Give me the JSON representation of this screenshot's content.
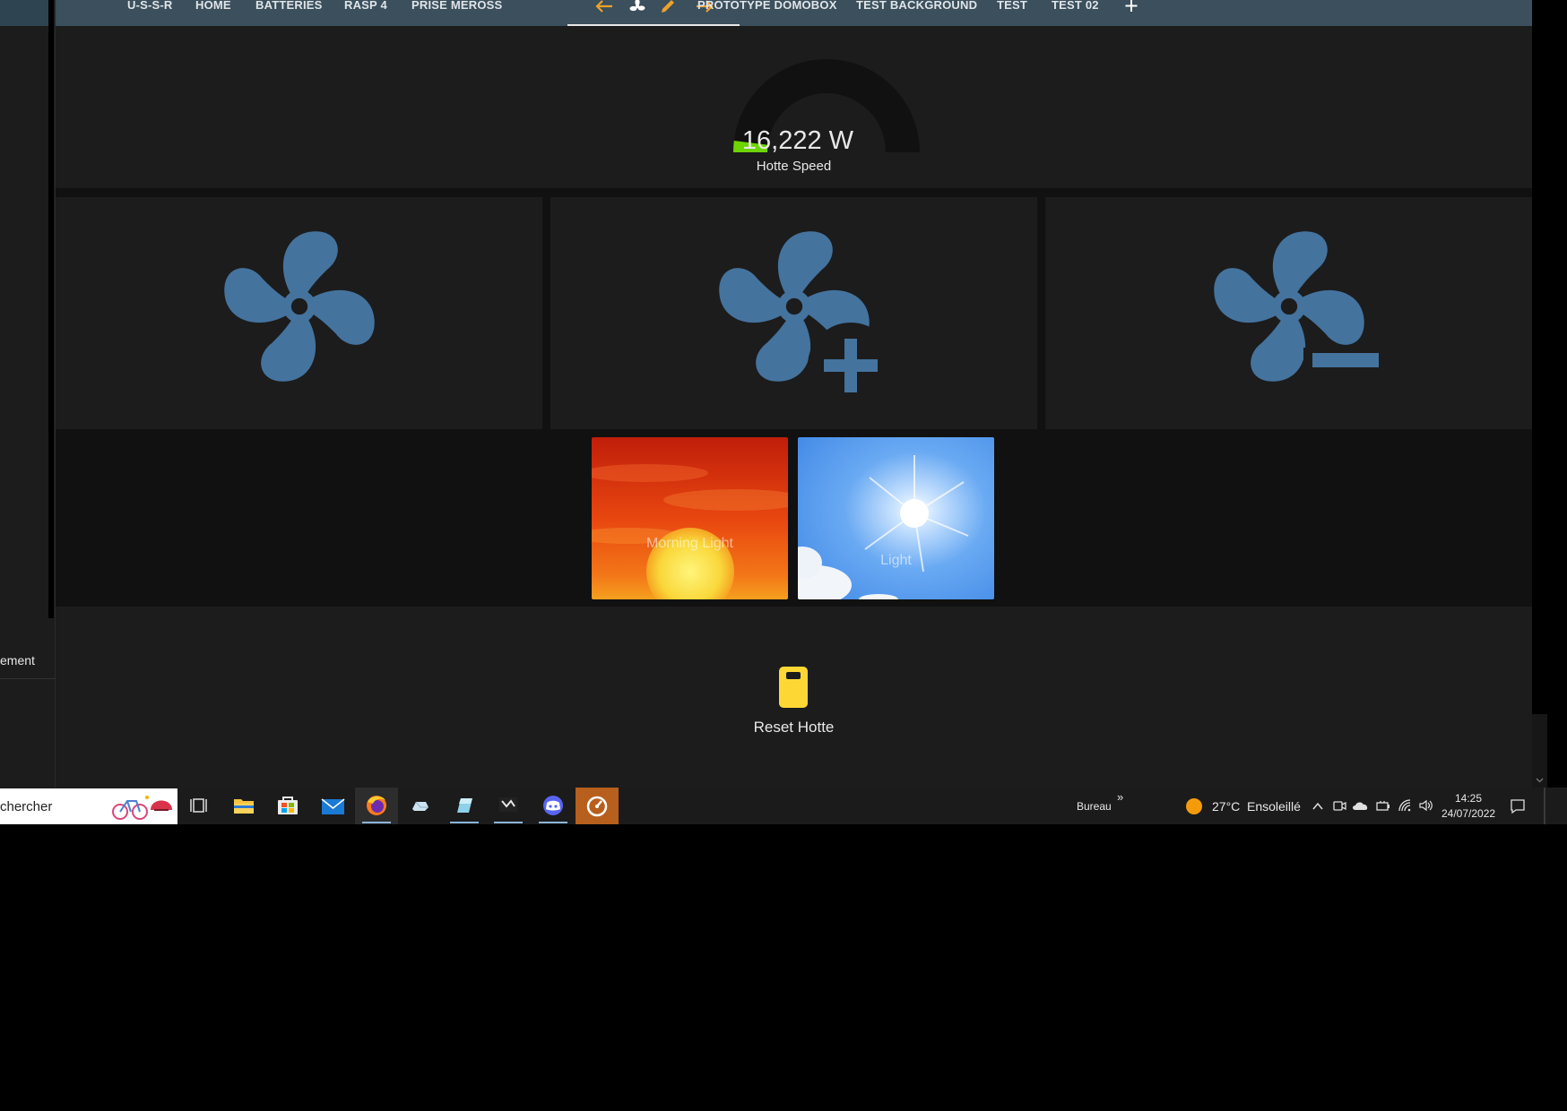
{
  "sidebar": {
    "item_label": "ement"
  },
  "tabs": [
    {
      "label": "U-S-S-R"
    },
    {
      "label": "HOME"
    },
    {
      "label": "BATTERIES"
    },
    {
      "label": "RASP 4"
    },
    {
      "label": "PRISE MEROSS"
    },
    {
      "label": "PROTOTYPE DOMOBOX"
    },
    {
      "label": "TEST BACKGROUND"
    },
    {
      "label": "TEST"
    },
    {
      "label": "TEST 02"
    }
  ],
  "tab_tools": {
    "left_arrow": "arrow-left-icon",
    "fan": "fan-icon",
    "edit": "pencil-icon",
    "right_arrow": "arrow-right-icon",
    "add": "plus-icon",
    "accent_color": "#f0a12a"
  },
  "gauge": {
    "value": "16,222 W",
    "label": "Hotte Speed",
    "level_fraction": 0.04,
    "fill_color": "#6dd400",
    "track_color": "#111111"
  },
  "buttons": [
    {
      "icon": "fan-icon"
    },
    {
      "icon": "fan-plus-icon"
    },
    {
      "icon": "fan-minus-icon"
    }
  ],
  "icon_color": "#44739e",
  "scenes": [
    {
      "label": "Morning Light",
      "icon": "sunset-image"
    },
    {
      "label": "Light",
      "icon": "sunny-sky-image"
    }
  ],
  "reset": {
    "label": "Reset Hotte",
    "icon": "switch-icon",
    "color": "#fdd835"
  },
  "taskbar": {
    "search_text": "chercher",
    "desktop_label": "Bureau",
    "desktop_chevron": "»",
    "weather_temp": "27°C",
    "weather_text": "Ensoleillé",
    "time": "14:25",
    "date": "24/07/2022"
  }
}
